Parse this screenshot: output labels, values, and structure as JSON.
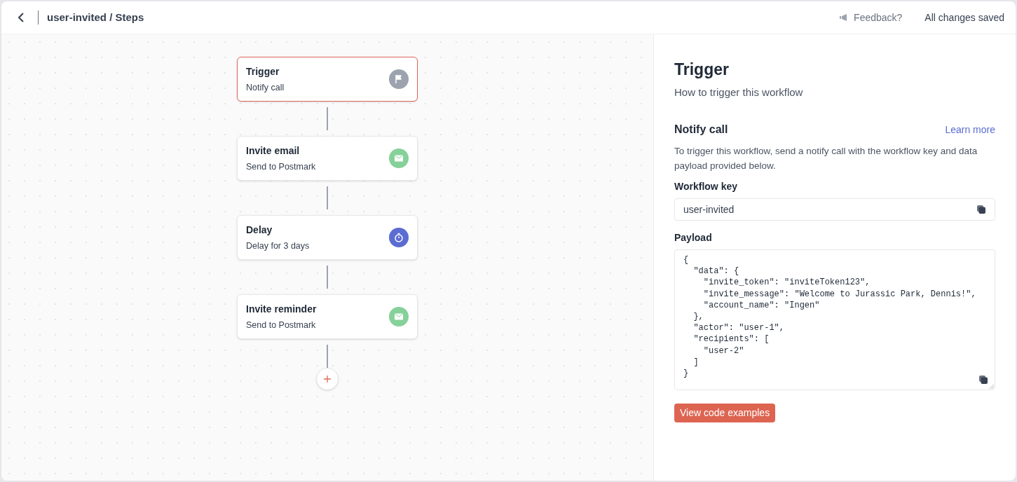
{
  "header": {
    "breadcrumb": "user-invited / Steps",
    "feedback": "Feedback?",
    "save_status": "All changes saved"
  },
  "steps": [
    {
      "kind": "trigger",
      "title": "Trigger",
      "subtitle": "Notify call",
      "selected": true
    },
    {
      "kind": "email",
      "title": "Invite email",
      "subtitle": "Send to Postmark",
      "selected": false
    },
    {
      "kind": "delay",
      "title": "Delay",
      "subtitle": "Delay for 3 days",
      "selected": false
    },
    {
      "kind": "email",
      "title": "Invite reminder",
      "subtitle": "Send to Postmark",
      "selected": false
    }
  ],
  "panel": {
    "title": "Trigger",
    "subtitle": "How to trigger this workflow",
    "section_title": "Notify call",
    "learn_more": "Learn more",
    "description": "To trigger this workflow, send a notify call with the workflow key and data payload provided below.",
    "workflow_key_label": "Workflow key",
    "workflow_key": "user-invited",
    "payload_label": "Payload",
    "payload": "{\n  \"data\": {\n    \"invite_token\": \"inviteToken123\",\n    \"invite_message\": \"Welcome to Jurassic Park, Dennis!\",\n    \"account_name\": \"Ingen\"\n  },\n  \"actor\": \"user-1\",\n  \"recipients\": [\n    \"user-2\"\n  ]\n}",
    "button": "View code examples"
  }
}
